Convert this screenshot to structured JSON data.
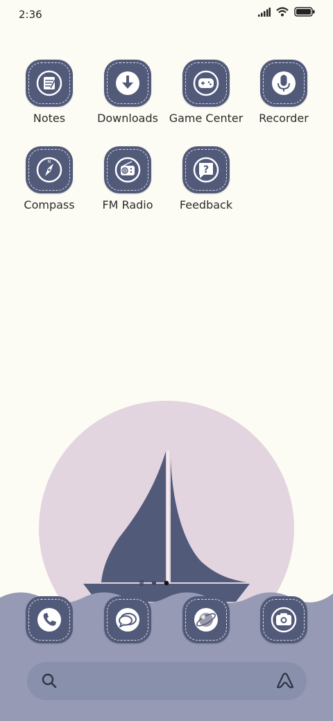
{
  "status_bar": {
    "time": "2:36",
    "icons": [
      "signal-icon",
      "wifi-icon",
      "battery-icon"
    ]
  },
  "apps": [
    {
      "label": "Notes",
      "icon": "notes-icon"
    },
    {
      "label": "Downloads",
      "icon": "download-icon"
    },
    {
      "label": "Game Center",
      "icon": "gamepad-icon"
    },
    {
      "label": "Recorder",
      "icon": "microphone-icon"
    },
    {
      "label": "Compass",
      "icon": "compass-icon"
    },
    {
      "label": "FM Radio",
      "icon": "radio-icon"
    },
    {
      "label": "Feedback",
      "icon": "feedback-icon"
    }
  ],
  "dock": [
    {
      "icon": "phone-icon"
    },
    {
      "icon": "messages-icon"
    },
    {
      "icon": "browser-icon"
    },
    {
      "icon": "camera-icon"
    }
  ],
  "page_indicator": {
    "pages": 3,
    "active": 2
  },
  "search": {
    "icon": "search-icon",
    "assistant_icon": "assistant-icon"
  },
  "colors": {
    "background": "#fdfcf4",
    "icon_fill": "#525a7a",
    "moon": "#e3d5df",
    "sea": "#969ab5",
    "search_bar": "#8890ab"
  }
}
